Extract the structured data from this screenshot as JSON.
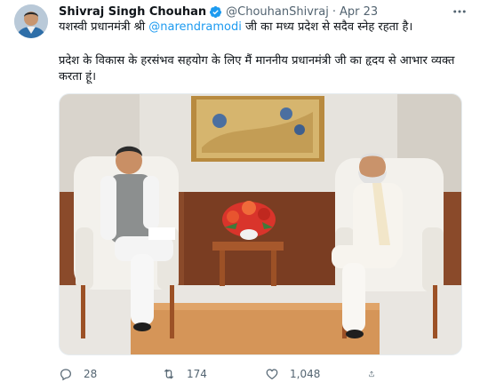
{
  "tweet": {
    "display_name": "Shivraj Singh Chouhan",
    "handle": "@ChouhanShivraj",
    "separator": "·",
    "date": "Apr 23",
    "line1_prefix": "यशस्वी प्रधानमंत्री श्री ",
    "mention": "@narendramodi",
    "line1_suffix": " जी का मध्य प्रदेश से सदैव स्नेह रहता है।",
    "paragraph2": "प्रदेश के विकास के हरसंभव सहयोग के लिए मैं माननीय प्रधानमंत्री जी का हृदय से आभार व्यक्त करता हूं।"
  },
  "stats": {
    "replies": "28",
    "retweets": "174",
    "likes": "1,048"
  },
  "icons": {
    "verified": "verified-badge-icon",
    "more": "more-options-icon",
    "reply": "reply-icon",
    "retweet": "retweet-icon",
    "like": "like-icon",
    "share": "share-icon"
  },
  "colors": {
    "accent": "#1d9bf0",
    "secondary_text": "#536471",
    "primary_text": "#0f1419"
  }
}
